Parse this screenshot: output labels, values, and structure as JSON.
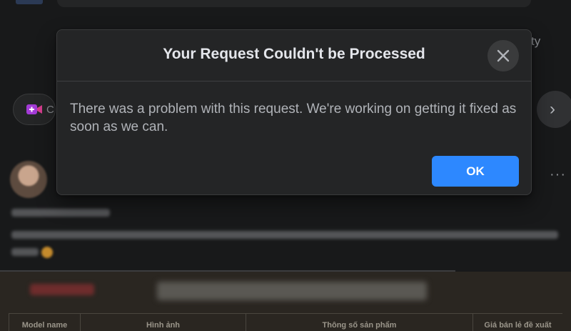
{
  "dialog": {
    "title": "Your Request Couldn't be Processed",
    "message": "There was a problem with this request. We're working on getting it fixed as soon as we can.",
    "ok_label": "OK",
    "close_icon": "close-icon"
  },
  "background": {
    "right_hint": "ty",
    "room_chip_letter": "C",
    "arrow_glyph": "›",
    "more_glyph": "···",
    "product_table_headers": [
      "Model name",
      "Hình ảnh",
      "Thông số sản phẩm",
      "Giá bán lẻ đề xuất"
    ]
  },
  "colors": {
    "accent": "#2d88ff",
    "dialog_bg": "#242526",
    "page_bg": "#18191a"
  }
}
